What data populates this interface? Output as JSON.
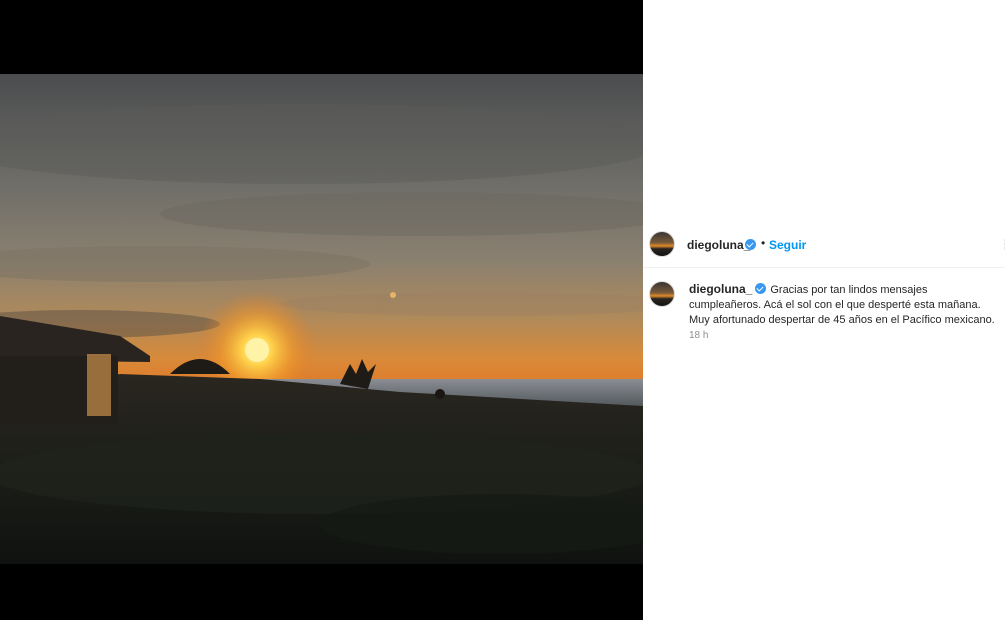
{
  "post": {
    "author": {
      "username": "diegoluna_",
      "verified": true
    },
    "header": {
      "separator": "•",
      "follow_label": "Seguir",
      "more_icon": "more-options-icon"
    },
    "caption": {
      "username": "diegoluna_",
      "text": "Gracias por tan lindos mensajes cumpleañeros. Acá el sol con el que desperté esta mañana. Muy afortunado despertar de 45 años en el Pacífico mexicano."
    },
    "timestamp": "18 h",
    "media": {
      "description_icon": "photo"
    }
  },
  "colors": {
    "link_blue": "#0095f6",
    "verified_blue": "#3897f0",
    "text_primary": "#262626",
    "text_secondary": "#8e8e8e",
    "media_background": "#000000"
  }
}
